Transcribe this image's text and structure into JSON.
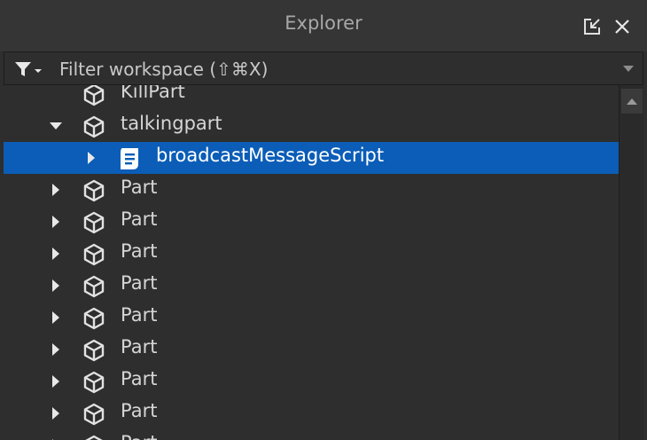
{
  "window": {
    "title": "Explorer"
  },
  "titlebar": {
    "icons": [
      "undock-icon",
      "close-icon"
    ]
  },
  "filter": {
    "placeholder": "Filter workspace (⇧⌘X)",
    "icon": "filter-icon"
  },
  "tree": {
    "items": [
      {
        "label": "KillPart",
        "expander": "none",
        "icon": "part-icon"
      },
      {
        "label": "talkingpart",
        "expander": "expanded",
        "icon": "part-icon"
      },
      {
        "label": "broadcastMessageScript",
        "expander": "collapsed",
        "icon": "script-icon",
        "selected": true
      },
      {
        "label": "Part",
        "expander": "collapsed",
        "icon": "part-icon"
      },
      {
        "label": "Part",
        "expander": "collapsed",
        "icon": "part-icon"
      },
      {
        "label": "Part",
        "expander": "collapsed",
        "icon": "part-icon"
      },
      {
        "label": "Part",
        "expander": "collapsed",
        "icon": "part-icon"
      },
      {
        "label": "Part",
        "expander": "collapsed",
        "icon": "part-icon"
      },
      {
        "label": "Part",
        "expander": "collapsed",
        "icon": "part-icon"
      },
      {
        "label": "Part",
        "expander": "collapsed",
        "icon": "part-icon"
      },
      {
        "label": "Part",
        "expander": "collapsed",
        "icon": "part-icon"
      },
      {
        "label": "Part",
        "expander": "collapsed",
        "icon": "part-icon"
      }
    ]
  },
  "colors": {
    "background": "#2e2e2e",
    "selection": "#0b5db7",
    "text": "#d6d6d6"
  }
}
